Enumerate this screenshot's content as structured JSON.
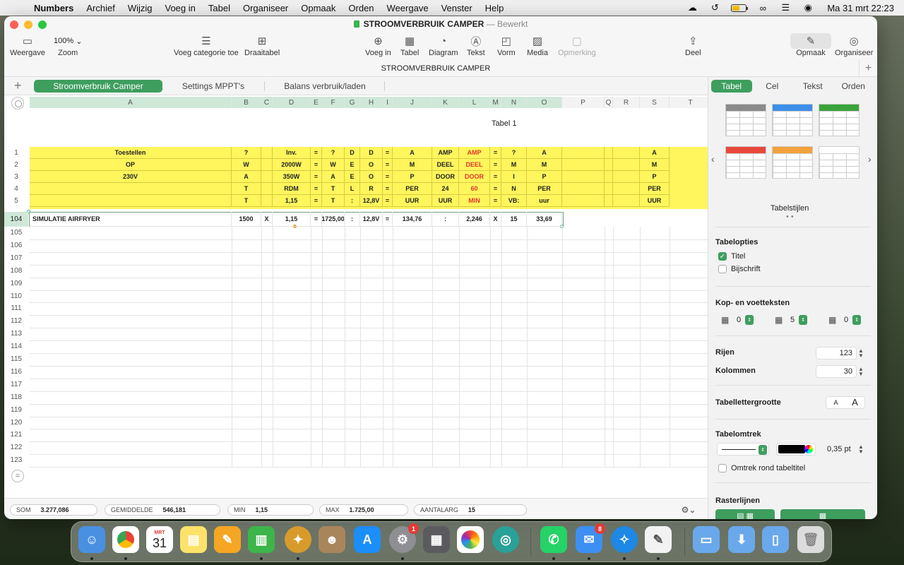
{
  "menubar": {
    "app_name": "Numbers",
    "items": [
      "Archief",
      "Wijzig",
      "Voeg in",
      "Tabel",
      "Organiseer",
      "Opmaak",
      "Orden",
      "Weergave",
      "Venster",
      "Help"
    ],
    "clock": "Ma 31 mrt  22:23",
    "battery_level": 0.55,
    "battery_color": "#f5c400"
  },
  "window": {
    "doc_title": "STROOMVERBRUIK CAMPER",
    "doc_state": "— Bewerkt",
    "sheet_title": "STROOMVERBRUIK CAMPER",
    "toolbar": {
      "weergave": "Weergave",
      "zoom_value": "100%",
      "zoom": "Zoom",
      "voeg_categorie": "Voeg categorie toe",
      "draaitabel": "Draaitabel",
      "voeg_in": "Voeg in",
      "tabel": "Tabel",
      "diagram": "Diagram",
      "tekst": "Tekst",
      "vorm": "Vorm",
      "media": "Media",
      "opmerking": "Opmerking",
      "deel": "Deel",
      "opmaak": "Opmaak",
      "organiseer": "Organiseer"
    },
    "sheets": [
      "Stroomverbruik Camper",
      "Settings MPPT's",
      "Balans verbruik/laden"
    ]
  },
  "grid": {
    "table_title": "Tabel 1",
    "columns": [
      "A",
      "B",
      "C",
      "D",
      "E",
      "F",
      "G",
      "H",
      "I",
      "J",
      "K",
      "L",
      "M",
      "N",
      "O",
      "P",
      "Q",
      "R",
      "S",
      "T"
    ],
    "header_rows": [
      {
        "num": "1",
        "cells": [
          "Toestellen",
          "?",
          "",
          "Inv.",
          "=",
          "?",
          "D",
          "D",
          "=",
          "A",
          "AMP",
          "AMP",
          "=",
          "?",
          "A",
          "",
          "",
          "",
          "A"
        ]
      },
      {
        "num": "2",
        "cells": [
          "OP",
          "W",
          "",
          "2000W",
          "=",
          "W",
          "E",
          "O",
          "=",
          "M",
          "DEEL",
          "DEEL",
          "=",
          "M",
          "M",
          "",
          "",
          "",
          "M"
        ]
      },
      {
        "num": "3",
        "cells": [
          "230V",
          "A",
          "",
          "350W",
          "=",
          "A",
          "E",
          "O",
          "=",
          "P",
          "DOOR",
          "DOOR",
          "=",
          "I",
          "P",
          "",
          "",
          "",
          "P"
        ]
      },
      {
        "num": "4",
        "cells": [
          "",
          "T",
          "",
          "RDM",
          "=",
          "T",
          "L",
          "R",
          "=",
          "PER",
          "24",
          "60",
          "=",
          "N",
          "PER",
          "",
          "",
          "",
          "PER"
        ]
      },
      {
        "num": "5",
        "cells": [
          "",
          "T",
          "",
          "1,15",
          "=",
          "T",
          ":",
          "12,8V",
          "=",
          "UUR",
          "UUR",
          "MIN",
          "=",
          "VB:",
          "uur",
          "",
          "",
          "",
          "UUR"
        ]
      }
    ],
    "data_row": {
      "num": "104",
      "cells": [
        "SIMULATIE AIRFRYER",
        "1500",
        "X",
        "1,15",
        "=",
        "1725,00",
        ":",
        "12,8V",
        "=",
        "134,76",
        ":",
        "",
        "2,246",
        "X",
        "15",
        "33,69"
      ]
    },
    "empty_rows": [
      "105",
      "106",
      "107",
      "108",
      "109",
      "110",
      "111",
      "112",
      "113",
      "114",
      "115",
      "116",
      "117",
      "118",
      "119",
      "120",
      "121",
      "122",
      "123"
    ],
    "header_color": "#fff55c",
    "accent_red": "#e0382c"
  },
  "status": {
    "som_label": "SOM",
    "som_value": "3.277,086",
    "gem_label": "GEMIDDELDE",
    "gem_value": "546,181",
    "min_label": "MIN",
    "min_value": "1,15",
    "max_label": "MAX",
    "max_value": "1.725,00",
    "aantal_label": "AANTALARG",
    "aantal_value": "15"
  },
  "inspector": {
    "tabs": [
      "Tabel",
      "Cel",
      "Tekst",
      "Orden"
    ],
    "styles_label": "Tabelstijlen",
    "style_colors": [
      "#8a8a8a",
      "#3c8fe8",
      "#3aa33a",
      "#e8483c",
      "#f2a23c",
      "#ffffff"
    ],
    "tabelopties": "Tabelopties",
    "titel": "Titel",
    "bijschrift": "Bijschrift",
    "kop_voet": "Kop- en voetteksten",
    "kop_vals": [
      "0",
      "5",
      "0"
    ],
    "rijen_label": "Rijen",
    "rijen_value": "123",
    "kolommen_label": "Kolommen",
    "kolommen_value": "30",
    "lettergrootte": "Tabellettergrootte",
    "font_small": "A",
    "font_large": "A",
    "omtrek": "Tabelomtrek",
    "omtrek_value": "0,35 pt",
    "omtrek_titel": "Omtrek rond tabeltitel",
    "rasterlijnen": "Rasterlijnen",
    "accent": "#3e9e5e"
  },
  "dock": {
    "calendar_month": "MRT",
    "calendar_day": "31",
    "settings_badge": "1",
    "mail_badge": "8"
  }
}
